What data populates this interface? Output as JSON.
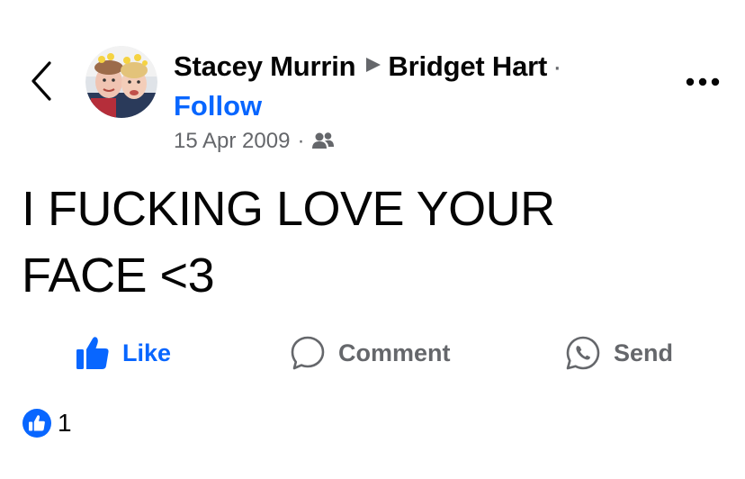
{
  "header": {
    "author": "Stacey Murrin",
    "recipient": "Bridget Hart",
    "dot": "·",
    "follow_label": "Follow"
  },
  "meta": {
    "date": "15 Apr 2009",
    "separator": "·",
    "audience_icon": "friends-icon"
  },
  "post": {
    "text": "I FUCKING LOVE YOUR FACE <3"
  },
  "actions": {
    "like_label": "Like",
    "comment_label": "Comment",
    "send_label": "Send"
  },
  "reactions": {
    "count": "1",
    "icon": "like-reaction-icon"
  },
  "colors": {
    "accent": "#0866ff",
    "secondary_text": "#65676b",
    "primary_text": "#050505"
  }
}
